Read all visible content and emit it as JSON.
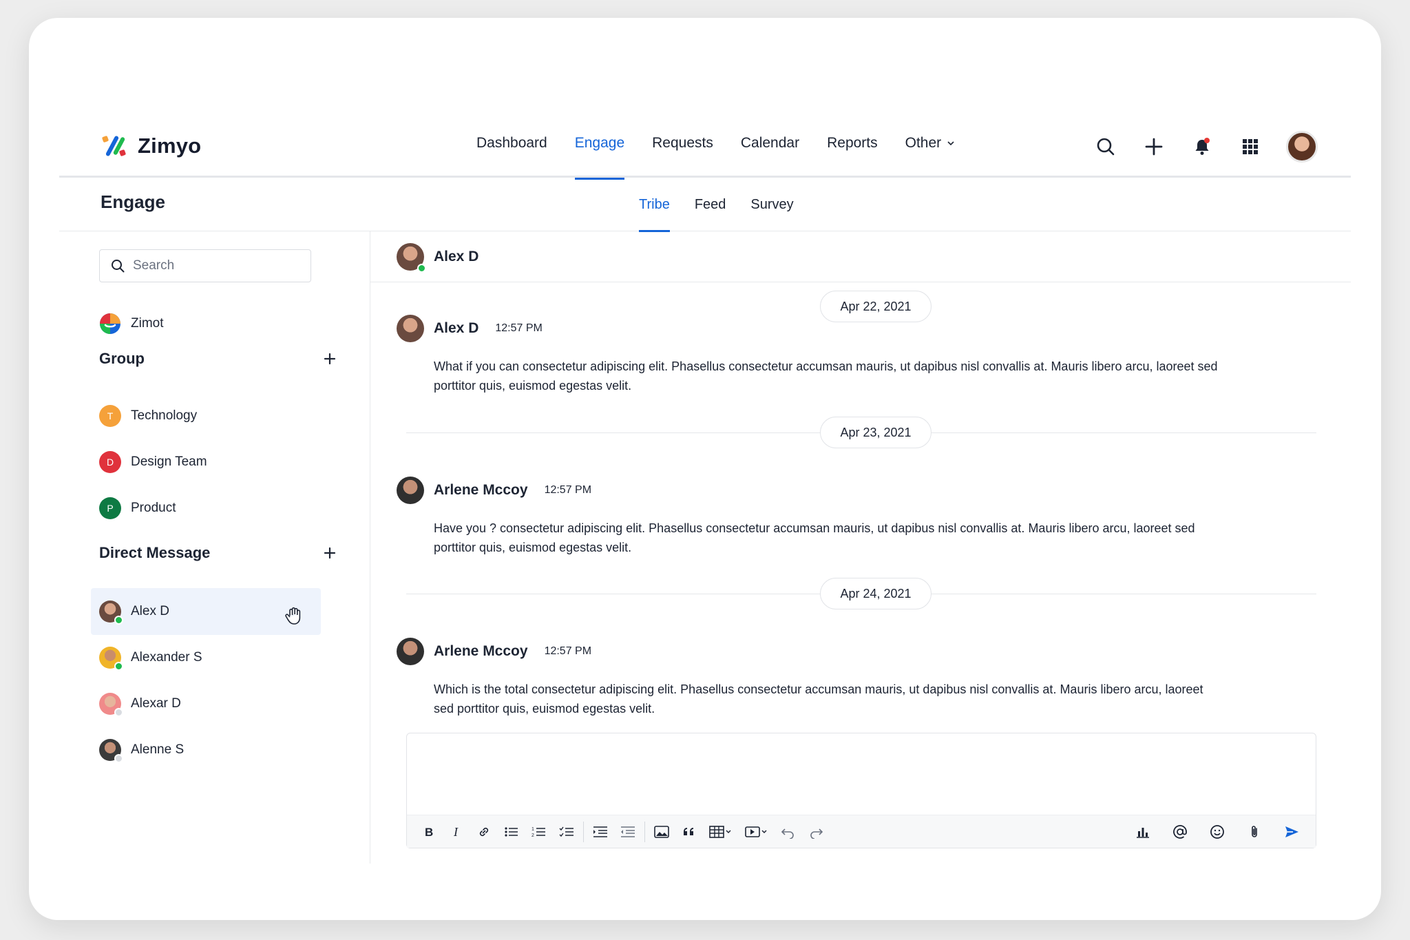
{
  "app": {
    "name": "Zimyo"
  },
  "nav": {
    "items": [
      {
        "label": "Dashboard",
        "active": false
      },
      {
        "label": "Engage",
        "active": true
      },
      {
        "label": "Requests",
        "active": false
      },
      {
        "label": "Calendar",
        "active": false
      },
      {
        "label": "Reports",
        "active": false
      },
      {
        "label": "Other",
        "active": false,
        "dropdown": true
      }
    ],
    "actions": [
      "search-icon",
      "plus-icon",
      "bell-icon",
      "apps-grid-icon",
      "profile-avatar"
    ],
    "notification_dot_color": "#e53935"
  },
  "page": {
    "title": "Engage",
    "tabs": [
      {
        "label": "Tribe",
        "active": true
      },
      {
        "label": "Feed",
        "active": false
      },
      {
        "label": "Survey",
        "active": false
      }
    ]
  },
  "sidebar": {
    "search_placeholder": "Search",
    "bot": {
      "label": "Zimot"
    },
    "group_title": "Group",
    "groups": [
      {
        "initial": "T",
        "label": "Technology",
        "color": "#f5a13a"
      },
      {
        "initial": "D",
        "label": "Design Team",
        "color": "#e0323c"
      },
      {
        "initial": "P",
        "label": "Product",
        "color": "#0e7a43"
      }
    ],
    "dm_title": "Direct Message",
    "dms": [
      {
        "label": "Alex D",
        "status": "online",
        "selected": true
      },
      {
        "label": "Alexander S",
        "status": "online",
        "selected": false
      },
      {
        "label": "Alexar D",
        "status": "offline",
        "selected": false
      },
      {
        "label": "Alenne S",
        "status": "offline",
        "selected": false
      }
    ]
  },
  "chat": {
    "header_name": "Alex D",
    "dates": [
      "Apr 22, 2021",
      "Apr 23, 2021",
      "Apr 24, 2021"
    ],
    "messages": [
      {
        "author": "Alex D",
        "time": "12:57 PM",
        "text": "What if you can consectetur adipiscing elit. Phasellus consectetur accumsan mauris, ut dapibus nisl convallis at. Mauris libero arcu, laoreet sed porttitor quis, euismod egestas velit."
      },
      {
        "author": "Arlene Mccoy",
        "time": "12:57 PM",
        "text": "Have you ? consectetur adipiscing elit. Phasellus consectetur accumsan mauris, ut dapibus nisl convallis at. Mauris libero arcu, laoreet sed porttitor quis, euismod egestas velit."
      },
      {
        "author": "Arlene Mccoy",
        "time": "12:57 PM",
        "text": "Which is the total consectetur adipiscing elit. Phasellus consectetur accumsan mauris, ut dapibus nisl convallis at. Mauris libero arcu, laoreet sed porttitor quis, euismod egestas velit."
      }
    ],
    "composer": {
      "value": "",
      "toolbar_left": [
        "bold-icon",
        "italic-icon",
        "link-icon",
        "bullet-list-icon",
        "numbered-list-icon",
        "checklist-icon",
        "indent-icon",
        "outdent-icon",
        "image-icon",
        "quote-icon",
        "table-icon",
        "media-icon",
        "undo-icon",
        "redo-icon"
      ],
      "toolbar_right": [
        "poll-icon",
        "mention-icon",
        "emoji-icon",
        "attachment-icon",
        "send-icon"
      ],
      "send_color": "#1565d8"
    }
  },
  "colors": {
    "accent": "#1565d8",
    "online": "#1fba4f"
  }
}
